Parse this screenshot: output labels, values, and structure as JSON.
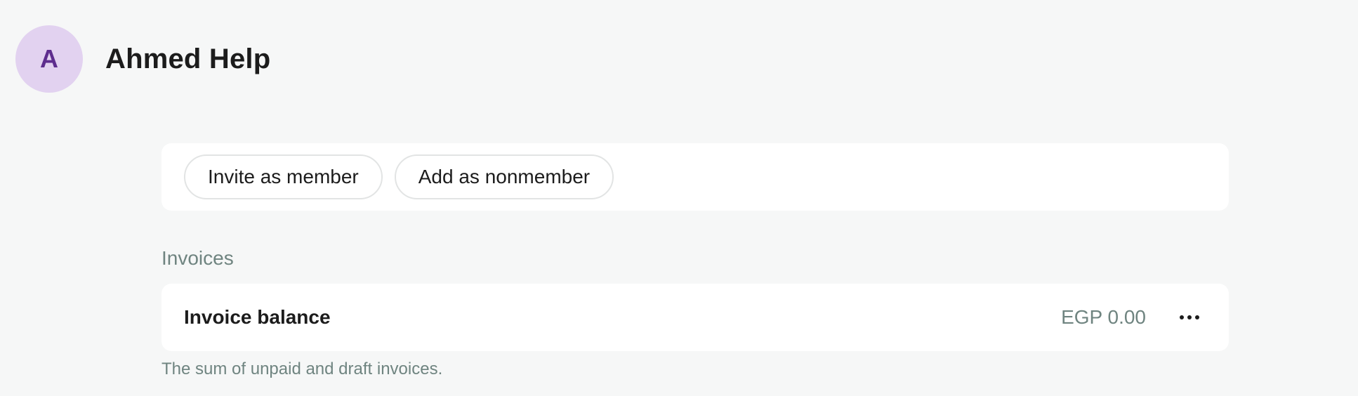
{
  "profile": {
    "avatar_initial": "A",
    "name": "Ahmed Help"
  },
  "actions": {
    "invite_label": "Invite as member",
    "nonmember_label": "Add as nonmember"
  },
  "invoices": {
    "section_title": "Invoices",
    "balance_label": "Invoice balance",
    "balance_amount": "EGP 0.00",
    "more_icon": "more-horizontal-icon",
    "hint": "The sum of unpaid and draft invoices."
  },
  "colors": {
    "background": "#f6f7f7",
    "avatar_bg": "#e2d2f0",
    "avatar_text": "#5e2d8e",
    "muted_text": "#6f8480",
    "card_bg": "#ffffff"
  }
}
